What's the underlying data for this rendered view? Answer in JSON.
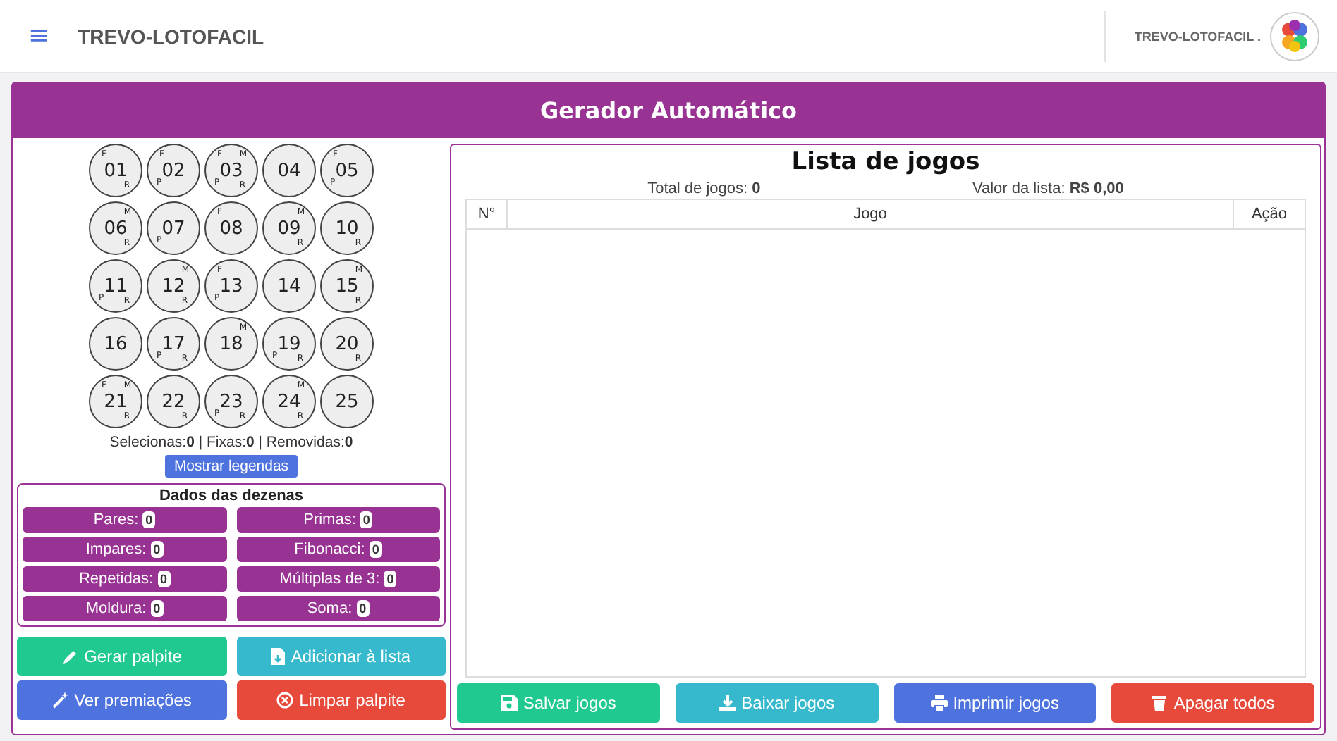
{
  "header": {
    "menu_icon": "≡",
    "title": "TREVO-LOTOFACIL",
    "user_label": "TREVO-LOTOFACIL ."
  },
  "card": {
    "title": "Gerador Automático"
  },
  "balls": [
    {
      "number": "01",
      "top_left": "F",
      "bottom_right": "R"
    },
    {
      "number": "02",
      "top_left": "F",
      "bottom_left": "P"
    },
    {
      "number": "03",
      "top_left": "F",
      "top_right": "M",
      "bottom_left": "P",
      "bottom_right": "R"
    },
    {
      "number": "04"
    },
    {
      "number": "05",
      "top_left": "F",
      "bottom_left": "P"
    },
    {
      "number": "06",
      "top_right": "M",
      "bottom_right": "R"
    },
    {
      "number": "07",
      "bottom_left": "P"
    },
    {
      "number": "08",
      "top_left": "F"
    },
    {
      "number": "09",
      "top_right": "M",
      "bottom_right": "R"
    },
    {
      "number": "10",
      "bottom_right": "R"
    },
    {
      "number": "11",
      "bottom_left": "P",
      "bottom_right": "R"
    },
    {
      "number": "12",
      "top_right": "M",
      "bottom_right": "R"
    },
    {
      "number": "13",
      "top_left": "F",
      "bottom_left": "P"
    },
    {
      "number": "14"
    },
    {
      "number": "15",
      "top_right": "M",
      "bottom_right": "R"
    },
    {
      "number": "16"
    },
    {
      "number": "17",
      "bottom_left": "P",
      "bottom_right": "R"
    },
    {
      "number": "18",
      "top_right": "M"
    },
    {
      "number": "19",
      "bottom_left": "P",
      "bottom_right": "R"
    },
    {
      "number": "20",
      "bottom_right": "R"
    },
    {
      "number": "21",
      "top_left": "F",
      "top_right": "M",
      "bottom_right": "R"
    },
    {
      "number": "22",
      "bottom_right": "R"
    },
    {
      "number": "23",
      "bottom_left": "P",
      "bottom_right": "R"
    },
    {
      "number": "24",
      "top_right": "M",
      "bottom_right": "R"
    },
    {
      "number": "25"
    }
  ],
  "counts": "Selecionas:**0** | Fixas:**0** | Removidas:**0**",
  "legend_button": "Mostrar legendas",
  "stats": {
    "title": "Dados das dezenas",
    "items": [
      {
        "label": "Pares:",
        "value": "0"
      },
      {
        "label": "Primas:",
        "value": "0"
      },
      {
        "label": "Impares:",
        "value": "0"
      },
      {
        "label": "Fibonacci:",
        "value": "0"
      },
      {
        "label": "Repetidas:",
        "value": "0"
      },
      {
        "label": "Múltiplas de 3:",
        "value": "0"
      },
      {
        "label": "Moldura:",
        "value": "0"
      },
      {
        "label": "Soma:",
        "value": "0"
      }
    ]
  },
  "left_buttons": [
    {
      "label": "Gerar palpite",
      "kind": "pencil",
      "color": "#20c98f"
    },
    {
      "label": "Adicionar à lista",
      "kind": "file",
      "color": "#36b9cc"
    },
    {
      "label": "Ver premiações",
      "kind": "wand",
      "color": "#4e73df"
    },
    {
      "label": "Limpar palpite",
      "kind": "x-circle",
      "color": "#e74a3b"
    }
  ],
  "list": {
    "title": "Lista de jogos",
    "total": "Total de jogos: **0**",
    "value": "Valor da lista: **R$ 0,00**",
    "columns": [
      "N°",
      "Jogo",
      "Ação"
    ]
  },
  "right_buttons": [
    {
      "label": "Salvar jogos",
      "kind": "save",
      "color": "#20c98f"
    },
    {
      "label": "Baixar jogos",
      "kind": "download",
      "color": "#36b9cc"
    },
    {
      "label": "Imprimir jogos",
      "kind": "print",
      "color": "#4e73df"
    },
    {
      "label": "Apagar todos",
      "kind": "trash",
      "color": "#e74a3b"
    }
  ]
}
